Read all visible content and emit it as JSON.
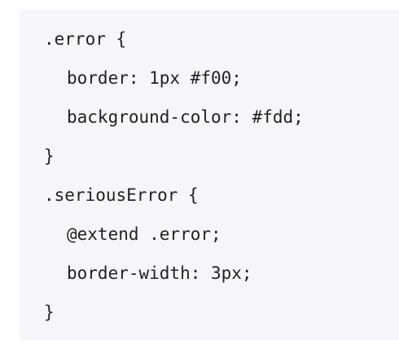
{
  "code": {
    "lines": [
      ".error {",
      "border: 1px #f00;",
      "background-color: #fdd;",
      "}",
      ".seriousError {",
      "@extend .error;",
      "border-width: 3px;",
      "}"
    ]
  }
}
